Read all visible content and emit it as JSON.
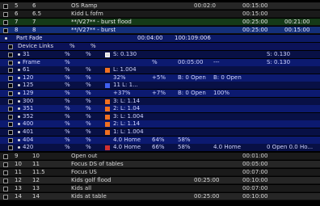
{
  "colors": {
    "cue_bg": "#262626",
    "green_bg": "#153a18",
    "blue_bg": "#14307a",
    "part_bg": "#0c1a66",
    "device_bg": "#081045",
    "orange": "#f07020"
  },
  "cues_top": [
    {
      "num": "5",
      "cue": "6",
      "label": "OS Ramp",
      "t1": "",
      "t2": "00:02:0",
      "t3": "00:15:00",
      "t4": "",
      "style": "cue"
    },
    {
      "num": "6",
      "cue": "6.5",
      "label": "Kidd L fofm",
      "t1": "",
      "t2": "",
      "t3": "00:15:00",
      "t4": "",
      "style": "alt"
    },
    {
      "num": "7",
      "cue": "7",
      "label": "**/V27** - burst flood",
      "t1": "",
      "t2": "",
      "t3": "00:25:00",
      "t4": "00:21:00",
      "style": "green"
    },
    {
      "num": "8",
      "cue": "8",
      "label": "**/V27** - burst",
      "t1": "",
      "t2": "",
      "t3": "00:25:00",
      "t4": "00:15:00",
      "style": "blue"
    }
  ],
  "part": {
    "label": "Part Fade",
    "time1": "00:04:00",
    "time2": "100:109:006"
  },
  "device_header": {
    "label": "Device Links",
    "c1": "%",
    "c2": "%"
  },
  "devices": [
    {
      "id": "31",
      "pct1": "%",
      "pct2": "%",
      "swatch": "white",
      "value": "S: 0.130",
      "extra1": "",
      "extra2": "",
      "extra3": "",
      "extra4": "S: 0.130"
    },
    {
      "id": "Frame",
      "pct1": "%",
      "pct2": "",
      "swatch": "none",
      "value": "",
      "extra1": "%",
      "extra2": "00:05:00",
      "extra3": "---",
      "extra4": "S: 0.130"
    },
    {
      "id": "61",
      "pct1": "%",
      "pct2": "%",
      "swatch": "orange",
      "value": "L: 1.004",
      "extra1": "",
      "extra2": "",
      "extra3": "",
      "extra4": ""
    },
    {
      "id": "120",
      "pct1": "%",
      "pct2": "%",
      "swatch": "none",
      "value": "32%",
      "extra1": "+5%",
      "extra2": "B: 0 Open",
      "extra3": "B: 0 Open",
      "extra4": ""
    },
    {
      "id": "125",
      "pct1": "%",
      "pct2": "%",
      "swatch": "blue",
      "value": "11 L: 1...",
      "extra1": "",
      "extra2": "",
      "extra3": "",
      "extra4": ""
    },
    {
      "id": "129",
      "pct1": "%",
      "pct2": "%",
      "swatch": "none",
      "value": "+37%",
      "extra1": "+7%",
      "extra2": "B: 0 Open",
      "extra3": "100%",
      "extra4": ""
    },
    {
      "id": "300",
      "pct1": "%",
      "pct2": "%",
      "swatch": "orange",
      "value": "3: L: 1.14",
      "extra1": "",
      "extra2": "",
      "extra3": "",
      "extra4": ""
    },
    {
      "id": "351",
      "pct1": "%",
      "pct2": "%",
      "swatch": "orange",
      "value": "2: L: 1.04",
      "extra1": "",
      "extra2": "",
      "extra3": "",
      "extra4": ""
    },
    {
      "id": "352",
      "pct1": "%",
      "pct2": "%",
      "swatch": "orange",
      "value": "3: L: 1.004",
      "extra1": "",
      "extra2": "",
      "extra3": "",
      "extra4": ""
    },
    {
      "id": "400",
      "pct1": "%",
      "pct2": "%",
      "swatch": "orange",
      "value": "2: L: 1.14",
      "extra1": "",
      "extra2": "",
      "extra3": "",
      "extra4": ""
    },
    {
      "id": "401",
      "pct1": "%",
      "pct2": "%",
      "swatch": "orange",
      "value": "1: L: 1.004",
      "extra1": "",
      "extra2": "",
      "extra3": "",
      "extra4": ""
    },
    {
      "id": "404",
      "pct1": "%",
      "pct2": "%",
      "swatch": "none",
      "value": "4.0 Home",
      "extra1": "64%",
      "extra2": "58%",
      "extra3": "",
      "extra4": ""
    },
    {
      "id": "420",
      "pct1": "%",
      "pct2": "%",
      "swatch": "red",
      "value": "4.0 Home",
      "extra1": "66%",
      "extra2": "58%",
      "extra3": "4.0 Home",
      "extra4": "0 Open  0.0 Ho..."
    }
  ],
  "cues_bottom": [
    {
      "num": "9",
      "cue": "10",
      "label": "Open out",
      "t1": "",
      "t2": "",
      "t3": "00:01:00",
      "t4": "",
      "style": "alt"
    },
    {
      "num": "10",
      "cue": "11",
      "label": "Focus DS of tables",
      "t1": "",
      "t2": "",
      "t3": "00:05:00",
      "t4": "",
      "style": "cue"
    },
    {
      "num": "11",
      "cue": "11.5",
      "label": "Focus US",
      "t1": "",
      "t2": "",
      "t3": "00:07:00",
      "t4": "",
      "style": "alt"
    },
    {
      "num": "12",
      "cue": "12",
      "label": "Kids golf flood",
      "t1": "",
      "t2": "00:25:00",
      "t3": "00:10:00",
      "t4": "",
      "style": "cue"
    },
    {
      "num": "13",
      "cue": "13",
      "label": "Kids all",
      "t1": "",
      "t2": "",
      "t3": "00:07:00",
      "t4": "",
      "style": "alt"
    },
    {
      "num": "14",
      "cue": "14",
      "label": "Kids at table",
      "t1": "",
      "t2": "00:25:00",
      "t3": "00:10:00",
      "t4": "",
      "style": "cue"
    },
    {
      "num": "15",
      "cue": "15",
      "label": "Laundry",
      "t1": "",
      "t2": "",
      "t3": "00:15:00",
      "t4": "",
      "style": "alt"
    }
  ]
}
